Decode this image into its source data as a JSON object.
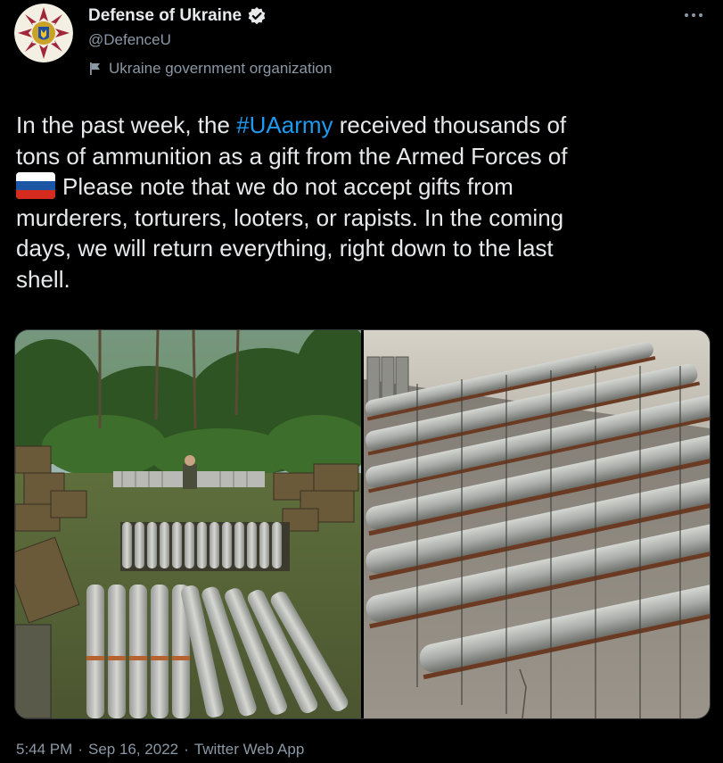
{
  "author": {
    "display_name": "Defense of Ukraine",
    "handle": "@DefenceU",
    "label": "Ukraine government organization",
    "avatar_icon": "ministry-of-defence-emblem-icon",
    "verified_icon": "verified-badge-icon"
  },
  "tweet": {
    "lines": [
      {
        "before": "In the past week, the ",
        "hashtag": "#UAarmy",
        "after": " received thousands of"
      },
      {
        "text": "tons of ammunition as a gift from the Armed Forces of"
      },
      {
        "flag_icon": "russia-flag-emoji",
        "text": "Please note that we do not accept gifts from"
      },
      {
        "text": "murderers, torturers, looters, or rapists. In the coming"
      },
      {
        "text": "days, we will return everything, right down to the last"
      },
      {
        "text": "shell."
      }
    ]
  },
  "media": [
    {
      "name": "ammunition-in-forest-photo"
    },
    {
      "name": "shells-on-concrete-floor-photo"
    }
  ],
  "footer": {
    "time": "5:44 PM",
    "separator": "·",
    "date": "Sep 16, 2022",
    "source": "Twitter Web App"
  },
  "colors": {
    "background": "#000000",
    "text": "#e7e9ea",
    "secondary": "#8b98a5",
    "link": "#1d9bf0"
  }
}
